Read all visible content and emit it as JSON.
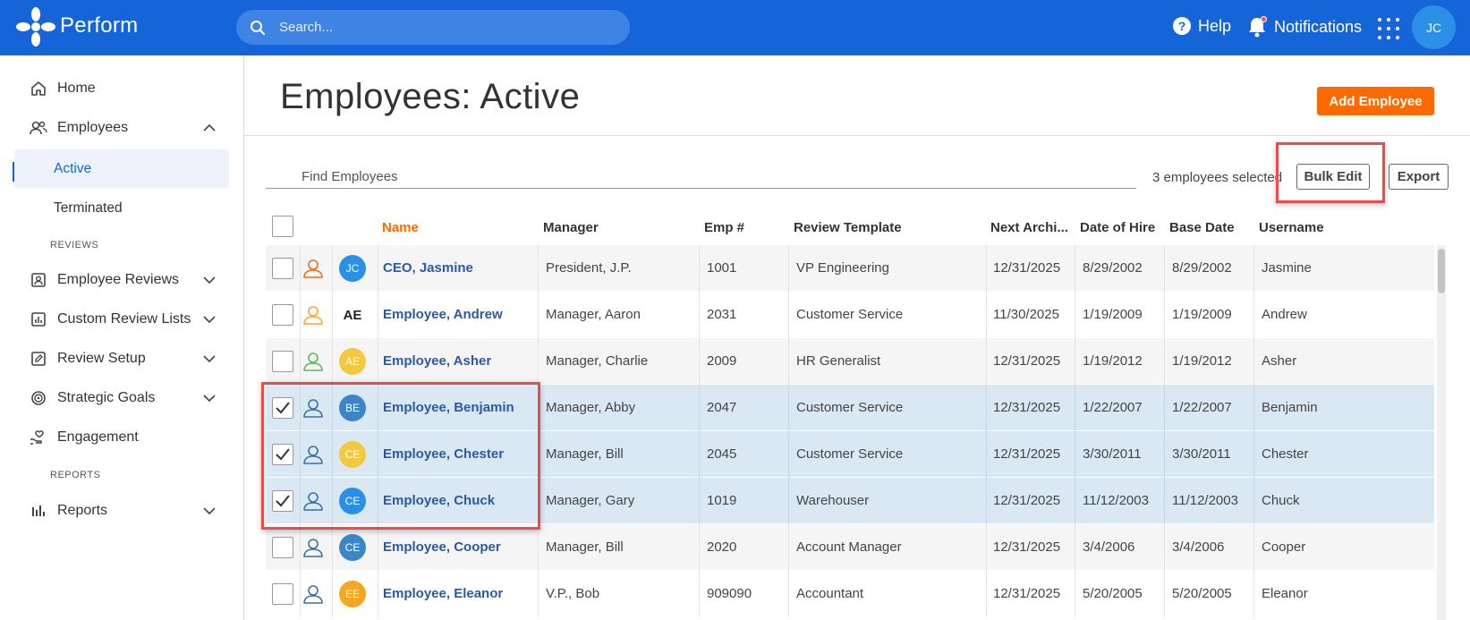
{
  "app": {
    "brand": "Perform",
    "avatar_initials": "JC"
  },
  "topbar": {
    "search_placeholder": "Search...",
    "help_label": "Help",
    "notifications_label": "Notifications"
  },
  "sidebar": {
    "home": "Home",
    "employees": "Employees",
    "active": "Active",
    "terminated": "Terminated",
    "reviews_section": "REVIEWS",
    "employee_reviews": "Employee Reviews",
    "custom_review_lists": "Custom Review Lists",
    "review_setup": "Review Setup",
    "strategic_goals": "Strategic Goals",
    "engagement": "Engagement",
    "reports_section": "REPORTS",
    "reports": "Reports"
  },
  "page": {
    "title": "Employees: Active",
    "add_employee_label": "Add Employee",
    "find_placeholder": "Find Employees",
    "selected_count_text": "3 employees selected",
    "bulk_edit_label": "Bulk Edit",
    "export_label": "Export"
  },
  "table": {
    "columns": [
      "Name",
      "Manager",
      "Emp #",
      "Review Template",
      "Next Archi...",
      "Date of Hire",
      "Base Date",
      "Username"
    ],
    "rows": [
      {
        "checked": false,
        "person_color": "#e8701a",
        "avatar": "JC",
        "avatar_color": "#2b8fe8",
        "name": "CEO, Jasmine",
        "manager": "President, J.P.",
        "emp": "1001",
        "template": "VP Engineering",
        "next": "12/31/2025",
        "hire": "8/29/2002",
        "base": "8/29/2002",
        "username": "Jasmine"
      },
      {
        "checked": false,
        "person_color": "#f2a83a",
        "avatar": "AE",
        "avatar_style": "text",
        "name": "Employee, Andrew",
        "manager": "Manager, Aaron",
        "emp": "2031",
        "template": "Customer Service",
        "next": "11/30/2025",
        "hire": "1/19/2009",
        "base": "1/19/2009",
        "username": "Andrew"
      },
      {
        "checked": false,
        "person_color": "#5cb85c",
        "avatar": "AE",
        "avatar_color": "#f5c842",
        "name": "Employee, Asher",
        "manager": "Manager, Charlie",
        "emp": "2009",
        "template": "HR Generalist",
        "next": "12/31/2025",
        "hire": "1/19/2012",
        "base": "1/19/2012",
        "username": "Asher"
      },
      {
        "checked": true,
        "person_color": "#3d6da8",
        "avatar": "BE",
        "avatar_color": "#3d86c6",
        "name": "Employee, Benjamin",
        "manager": "Manager, Abby",
        "emp": "2047",
        "template": "Customer Service",
        "next": "12/31/2025",
        "hire": "1/22/2007",
        "base": "1/22/2007",
        "username": "Benjamin"
      },
      {
        "checked": true,
        "person_color": "#3d6da8",
        "avatar": "CE",
        "avatar_color": "#f5c842",
        "name": "Employee, Chester",
        "manager": "Manager, Bill",
        "emp": "2045",
        "template": "Customer Service",
        "next": "12/31/2025",
        "hire": "3/30/2011",
        "base": "3/30/2011",
        "username": "Chester"
      },
      {
        "checked": true,
        "person_color": "#3d6da8",
        "avatar": "CE",
        "avatar_color": "#2b8fe8",
        "name": "Employee, Chuck",
        "manager": "Manager, Gary",
        "emp": "1019",
        "template": "Warehouser",
        "next": "12/31/2025",
        "hire": "11/12/2003",
        "base": "11/12/2003",
        "username": "Chuck"
      },
      {
        "checked": false,
        "person_color": "#3d6da8",
        "avatar": "CE",
        "avatar_color": "#3d86c6",
        "name": "Employee, Cooper",
        "manager": "Manager, Bill",
        "emp": "2020",
        "template": "Account Manager",
        "next": "12/31/2025",
        "hire": "3/4/2006",
        "base": "3/4/2006",
        "username": "Cooper"
      },
      {
        "checked": false,
        "person_color": "#3d6da8",
        "avatar": "EE",
        "avatar_color": "#f5a623",
        "name": "Employee, Eleanor",
        "manager": "V.P., Bob",
        "emp": "909090",
        "template": "Accountant",
        "next": "12/31/2025",
        "hire": "5/20/2005",
        "base": "5/20/2005",
        "username": "Eleanor"
      }
    ]
  }
}
